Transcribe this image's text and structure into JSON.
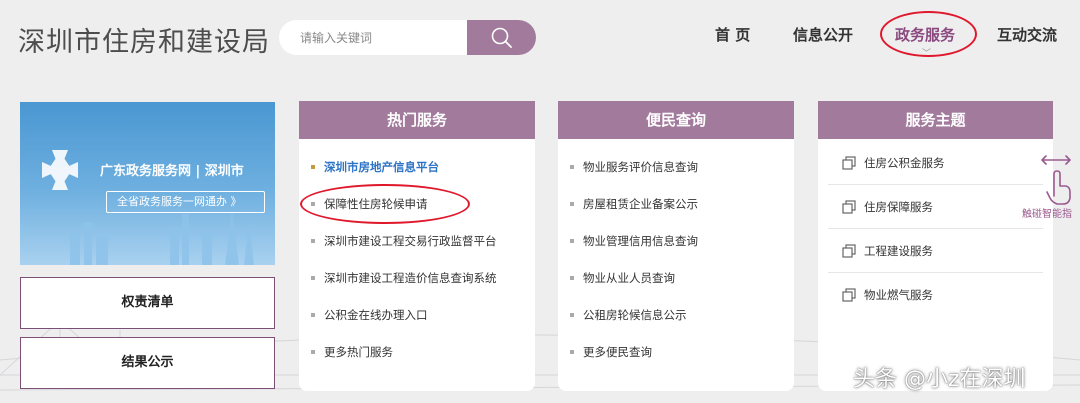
{
  "header": {
    "site_title": "深圳市住房和建设局",
    "search_placeholder": "请输入关键词"
  },
  "nav": {
    "items": [
      {
        "label": "首 页"
      },
      {
        "label": "信息公开"
      },
      {
        "label": "政务服务"
      },
      {
        "label": "互动交流"
      }
    ],
    "active_index": 2
  },
  "banner": {
    "title": "广东政务服务网 | 深圳市",
    "button_label": "全省政务服务一网通办 》"
  },
  "side_buttons": [
    {
      "label": "权责清单"
    },
    {
      "label": "结果公示"
    }
  ],
  "hot_services": {
    "heading": "热门服务",
    "items": [
      {
        "label": "深圳市房地产信息平台"
      },
      {
        "label": "保障性住房轮候申请"
      },
      {
        "label": "深圳市建设工程交易行政监督平台"
      },
      {
        "label": "深圳市建设工程造价信息查询系统"
      },
      {
        "label": "公积金在线办理入口"
      },
      {
        "label": "更多热门服务"
      }
    ]
  },
  "convenience": {
    "heading": "便民查询",
    "items": [
      {
        "label": "物业服务评价信息查询"
      },
      {
        "label": "房屋租赁企业备案公示"
      },
      {
        "label": "物业管理信用信息查询"
      },
      {
        "label": "物业从业人员查询"
      },
      {
        "label": "公租房轮候信息公示"
      },
      {
        "label": "更多便民查询"
      }
    ]
  },
  "topics": {
    "heading": "服务主题",
    "items": [
      {
        "label": "住房公积金服务"
      },
      {
        "label": "住房保障服务"
      },
      {
        "label": "工程建设服务"
      },
      {
        "label": "物业燃气服务"
      }
    ]
  },
  "gesture": {
    "label": "触碰智能指"
  },
  "watermark": "头条 @小z在深圳",
  "colors": {
    "accent": "#a27a9c",
    "active_nav": "#8b4a7f",
    "highlight_link": "#2e74c6",
    "annotation_red": "#e0182c"
  }
}
